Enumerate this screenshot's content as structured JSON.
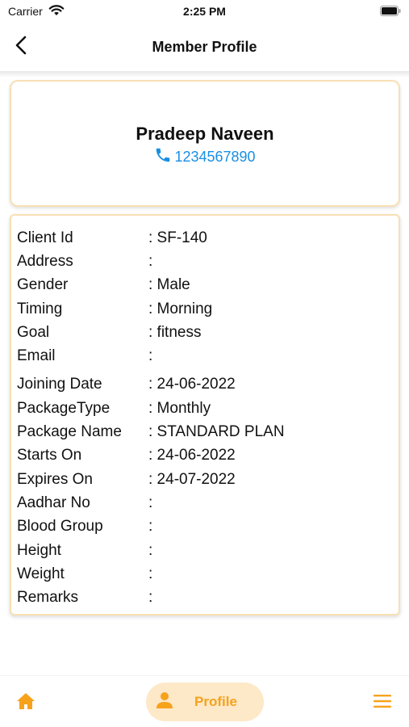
{
  "status_bar": {
    "carrier": "Carrier",
    "time": "2:25 PM",
    "wifi_icon": "wifi-icon",
    "battery_icon": "battery-icon"
  },
  "nav": {
    "title": "Member Profile",
    "back_icon": "chevron-left-icon"
  },
  "member": {
    "name": "Pradeep Naveen",
    "phone": "1234567890",
    "phone_icon": "phone-icon"
  },
  "details": [
    {
      "label": "Client Id",
      "value": ": SF-140"
    },
    {
      "label": "Address",
      "value": ":"
    },
    {
      "label": "Gender",
      "value": ": Male"
    },
    {
      "label": "Timing",
      "value": ": Morning"
    },
    {
      "label": "Goal",
      "value": ": fitness"
    },
    {
      "label": "Email",
      "value": ":"
    },
    {
      "label": "Joining Date",
      "value": ": 24-06-2022"
    },
    {
      "label": "PackageType",
      "value": ": Monthly"
    },
    {
      "label": "Package Name",
      "value": ": STANDARD PLAN"
    },
    {
      "label": "Starts On",
      "value": ": 24-06-2022"
    },
    {
      "label": "Expires On",
      "value": ": 24-07-2022"
    },
    {
      "label": "Aadhar No",
      "value": ":"
    },
    {
      "label": "Blood Group",
      "value": ":"
    },
    {
      "label": "Height",
      "value": ":"
    },
    {
      "label": "Weight",
      "value": ":"
    },
    {
      "label": "Remarks",
      "value": ":"
    }
  ],
  "tab_bar": {
    "home_icon": "home-icon",
    "profile_icon": "person-icon",
    "profile_label": "Profile",
    "menu_icon": "hamburger-menu-icon"
  },
  "colors": {
    "accent": "#f7a21b",
    "link": "#1a8fe3",
    "card_border": "#f7e0b4",
    "active_tab_bg": "#fde8c8"
  }
}
